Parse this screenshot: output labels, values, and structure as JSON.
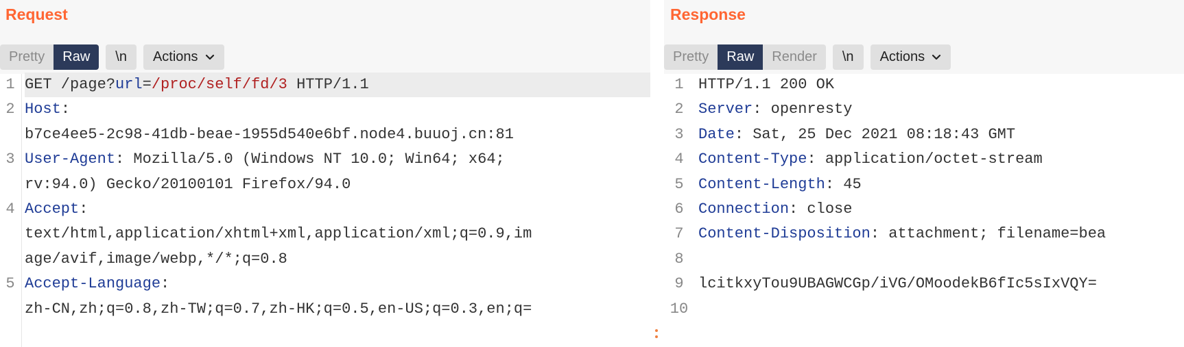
{
  "request": {
    "title": "Request",
    "tabs": [
      "Pretty",
      "Raw",
      "\\n"
    ],
    "active_tab": "Raw",
    "actions_label": "Actions",
    "lines": [
      {
        "num": "1",
        "segments": [
          {
            "t": "GET /page?",
            "c": "plain"
          },
          {
            "t": "url",
            "c": "param"
          },
          {
            "t": "=",
            "c": "plain"
          },
          {
            "t": "/proc/self/fd/3",
            "c": "val"
          },
          {
            "t": " HTTP/1.1",
            "c": "plain"
          }
        ]
      },
      {
        "num": "2",
        "segments": [
          {
            "t": "Host",
            "c": "key"
          },
          {
            "t": ":",
            "c": "plain"
          }
        ]
      },
      {
        "num": "",
        "segments": [
          {
            "t": "b7ce4ee5-2c98-41db-beae-1955d540e6bf.node4.buuoj.cn:81",
            "c": "plain"
          }
        ]
      },
      {
        "num": "3",
        "segments": [
          {
            "t": "User-Agent",
            "c": "key"
          },
          {
            "t": ": Mozilla/5.0 (Windows NT 10.0; Win64; x64;",
            "c": "plain"
          }
        ]
      },
      {
        "num": "",
        "segments": [
          {
            "t": "rv:94.0) Gecko/20100101 Firefox/94.0",
            "c": "plain"
          }
        ]
      },
      {
        "num": "4",
        "segments": [
          {
            "t": "Accept",
            "c": "key"
          },
          {
            "t": ":",
            "c": "plain"
          }
        ]
      },
      {
        "num": "",
        "segments": [
          {
            "t": "text/html,application/xhtml+xml,application/xml;q=0.9,im",
            "c": "plain"
          }
        ]
      },
      {
        "num": "",
        "segments": [
          {
            "t": "age/avif,image/webp,*/*;q=0.8",
            "c": "plain"
          }
        ]
      },
      {
        "num": "5",
        "segments": [
          {
            "t": "Accept-Language",
            "c": "key"
          },
          {
            "t": ":",
            "c": "plain"
          }
        ]
      },
      {
        "num": "",
        "segments": [
          {
            "t": "zh-CN,zh;q=0.8,zh-TW;q=0.7,zh-HK;q=0.5,en-US;q=0.3,en;q=",
            "c": "plain"
          }
        ]
      }
    ]
  },
  "response": {
    "title": "Response",
    "tabs": [
      "Pretty",
      "Raw",
      "Render",
      "\\n"
    ],
    "active_tab": "Raw",
    "actions_label": "Actions",
    "lines": [
      {
        "num": "1",
        "segments": [
          {
            "t": "HTTP/1.1 200 OK",
            "c": "plain"
          }
        ]
      },
      {
        "num": "2",
        "segments": [
          {
            "t": "Server",
            "c": "key"
          },
          {
            "t": ": openresty",
            "c": "plain"
          }
        ]
      },
      {
        "num": "3",
        "segments": [
          {
            "t": "Date",
            "c": "key"
          },
          {
            "t": ": Sat, 25 Dec 2021 08:18:43 GMT",
            "c": "plain"
          }
        ]
      },
      {
        "num": "4",
        "segments": [
          {
            "t": "Content-Type",
            "c": "key"
          },
          {
            "t": ": application/octet-stream",
            "c": "plain"
          }
        ]
      },
      {
        "num": "5",
        "segments": [
          {
            "t": "Content-Length",
            "c": "key"
          },
          {
            "t": ": 45",
            "c": "plain"
          }
        ]
      },
      {
        "num": "6",
        "segments": [
          {
            "t": "Connection",
            "c": "key"
          },
          {
            "t": ": close",
            "c": "plain"
          }
        ]
      },
      {
        "num": "7",
        "segments": [
          {
            "t": "Content-Disposition",
            "c": "key"
          },
          {
            "t": ": attachment; filename=bea",
            "c": "plain"
          }
        ]
      },
      {
        "num": "8",
        "segments": []
      },
      {
        "num": "9",
        "segments": [
          {
            "t": "lcitkxyTou9UBAGWCGp/iVG/OMoodekB6fIc5sIxVQY=",
            "c": "plain"
          }
        ]
      },
      {
        "num": "10",
        "segments": []
      }
    ]
  },
  "colors": {
    "accent": "#ff6633",
    "active_tab": "#2c3a5a",
    "header_key": "#1f3c96",
    "param_value": "#b02020"
  }
}
